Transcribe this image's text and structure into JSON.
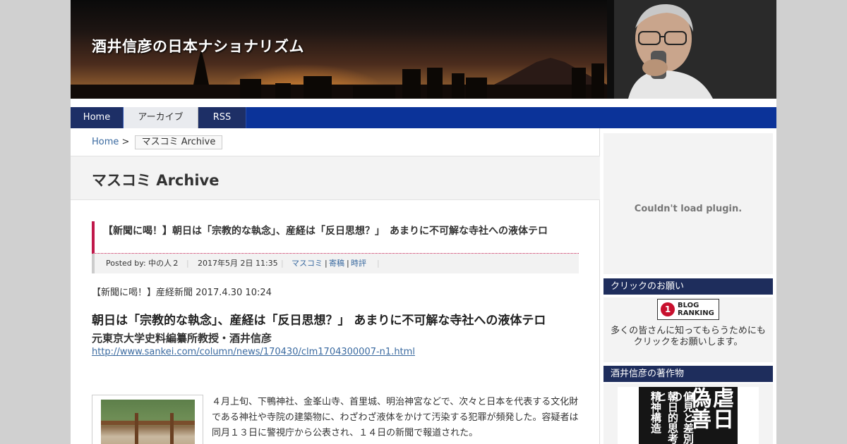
{
  "site": {
    "title": "酒井信彦の日本ナショナリズム"
  },
  "nav": {
    "items": [
      {
        "label": "Home"
      },
      {
        "label": "アーカイブ"
      },
      {
        "label": "RSS"
      }
    ]
  },
  "breadcrumb": {
    "home": "Home",
    "separator": ">",
    "current": "マスコミ Archive"
  },
  "archive": {
    "title": "マスコミ Archive"
  },
  "post": {
    "title": "【新聞に喝！】朝日は「宗教的な執念」、産経は「反日思想？」　あまりに不可解な寺社への液体テロ",
    "meta": {
      "posted_by": "Posted by: 中の人２",
      "date": "2017年5月 2日 11:35",
      "categories": [
        "マスコミ",
        "寄稿",
        "時評"
      ],
      "cat_sep": "|"
    },
    "lead": "【新聞に喝！】産経新聞 2017.4.30 10:24",
    "headline": "朝日は「宗教的な執念」、産経は「反日思想？」 あまりに不可解な寺社への液体テロ",
    "byline": "元東京大学史料編纂所教授・酒井信彦",
    "url": "http://www.sankei.com/column/news/170430/clm1704300007-n1.html",
    "body": "４月上旬、下鴨神社、金峯山寺、首里城、明治神宮などで、次々と日本を代表する文化財である神社や寺院の建築物に、わざわざ液体をかけて汚染する犯罪が頻発した。容疑者は同月１３日に警視庁から公表され、１４日の新聞で報道された。"
  },
  "sidebar": {
    "plugin_message": "Couldn't load plugin.",
    "widgets": [
      {
        "title": "クリックのお願い",
        "badge_top": "BLOG",
        "badge_bottom": "RANKING",
        "text": "多くの皆さんに知ってもらうためにもクリックをお願いします。"
      },
      {
        "title": "酒井信彦の著作物",
        "book_col1": "偏見と差別の",
        "book_col2": "朝日的思考と",
        "book_col3": "精神構造",
        "book_big": "虐日偽善"
      }
    ]
  },
  "colors": {
    "nav_bg": "#0b3399",
    "widget_head_bg": "#1e2d5c",
    "title_accent": "#c0184a",
    "link": "#3a6aa0"
  }
}
